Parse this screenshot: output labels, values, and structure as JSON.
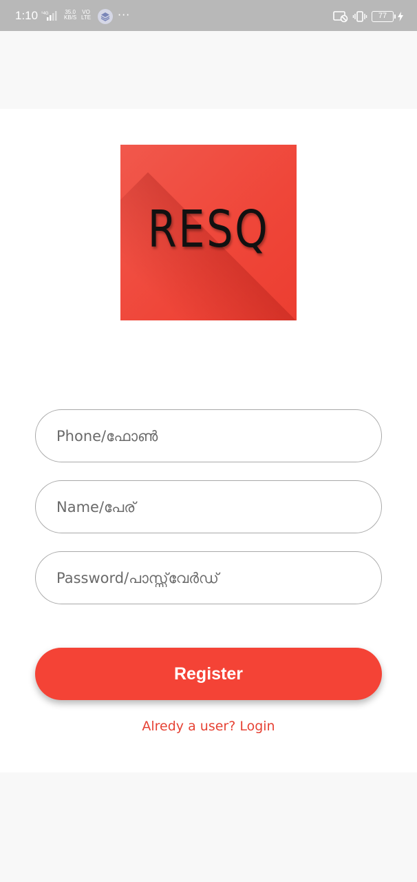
{
  "status_bar": {
    "time": "1:10",
    "network_speed": "35.0",
    "network_speed_unit": "KB/S",
    "volte": "VO",
    "lte": "LTE",
    "overflow": "···",
    "battery": "77",
    "icons": [
      "signal-4g-icon",
      "layers-icon",
      "cast-off-icon",
      "vibrate-icon",
      "battery-icon",
      "charging-icon"
    ]
  },
  "logo": {
    "text": "RESQ",
    "color": "#ef4639"
  },
  "form": {
    "phone_placeholder": "Phone/ഫോൺ",
    "name_placeholder": "Name/പേര്",
    "password_placeholder": "Password/പാസ്സ്‌വേർഡ്",
    "register_label": "Register",
    "login_link": "Alredy a user?  Login"
  },
  "colors": {
    "accent": "#f44336",
    "link": "#e64234",
    "status_bar": "#b8b8b8"
  }
}
